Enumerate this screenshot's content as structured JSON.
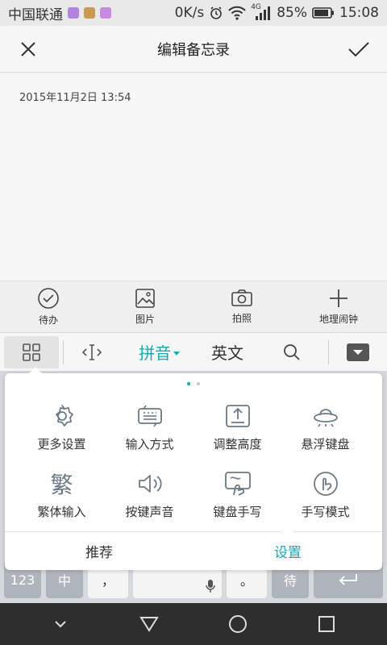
{
  "status": {
    "carrier": "中国联通",
    "network_speed": "0K/s",
    "network_type": "4G",
    "battery": "85%",
    "time": "15:08",
    "app_icon_colors": [
      "#b184e0",
      "#c79a52",
      "#c58be0"
    ]
  },
  "appbar": {
    "title": "编辑备忘录",
    "close_icon": "close-icon",
    "confirm_icon": "check-icon"
  },
  "editor": {
    "datetime": "2015年11月2日 13:54"
  },
  "toolbar": {
    "items": [
      {
        "label": "待办",
        "icon": "check-circle-icon"
      },
      {
        "label": "图片",
        "icon": "image-icon"
      },
      {
        "label": "拍照",
        "icon": "camera-icon"
      },
      {
        "label": "地理闹钟",
        "icon": "plus-icon"
      }
    ]
  },
  "ime": {
    "pinyin": "拼音",
    "english": "英文",
    "accent": "#1aa9b2"
  },
  "keyboard": {
    "num_key": "123",
    "zh_key": "中",
    "comma_key": "，",
    "period_key": "。",
    "dai_key": "待"
  },
  "popup": {
    "items": [
      {
        "label": "更多设置",
        "icon": "gear-icon"
      },
      {
        "label": "输入方式",
        "icon": "keyboard-switch-icon"
      },
      {
        "label": "调整高度",
        "icon": "height-adjust-icon"
      },
      {
        "label": "悬浮键盘",
        "icon": "ufo-icon"
      },
      {
        "label": "繁体输入",
        "glyph": "繁",
        "icon": "traditional-icon"
      },
      {
        "label": "按键声音",
        "icon": "speaker-icon"
      },
      {
        "label": "键盘手写",
        "icon": "keyboard-handwriting-icon"
      },
      {
        "label": "手写模式",
        "icon": "handwriting-mode-icon"
      }
    ],
    "tabs": [
      {
        "label": "推荐"
      },
      {
        "label": "设置"
      }
    ]
  }
}
